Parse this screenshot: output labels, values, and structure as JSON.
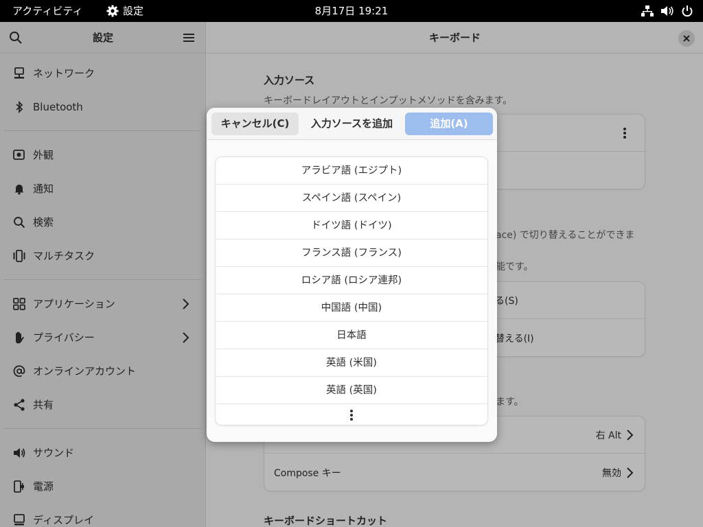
{
  "topbar": {
    "activities": "アクティビティ",
    "app_name": "設定",
    "clock": "8月17日 19:21",
    "tray_icons": [
      "network-icon",
      "volume-icon",
      "power-icon"
    ]
  },
  "sidebar": {
    "title": "設定",
    "groups": [
      [
        {
          "label": "ネットワーク",
          "icon": "network-icon"
        },
        {
          "label": "Bluetooth",
          "icon": "bluetooth-icon"
        }
      ],
      [
        {
          "label": "外観",
          "icon": "appearance-icon"
        },
        {
          "label": "通知",
          "icon": "bell-icon"
        },
        {
          "label": "検索",
          "icon": "search-icon"
        },
        {
          "label": "マルチタスク",
          "icon": "multitask-icon"
        }
      ],
      [
        {
          "label": "アプリケーション",
          "icon": "apps-icon",
          "chevron": true
        },
        {
          "label": "プライバシー",
          "icon": "hand-icon",
          "chevron": true
        },
        {
          "label": "オンラインアカウント",
          "icon": "at-icon"
        },
        {
          "label": "共有",
          "icon": "share-icon"
        }
      ],
      [
        {
          "label": "サウンド",
          "icon": "sound-icon"
        },
        {
          "label": "電源",
          "icon": "power-plug-icon"
        },
        {
          "label": "ディスプレイ",
          "icon": "display-icon"
        }
      ]
    ]
  },
  "main": {
    "title": "キーボード",
    "input_sources_heading": "入力ソース",
    "input_sources_desc": "キーボードレイアウトとインプットメソッドを含みます。",
    "switch_desc_partial": "ace) で切り替えることができま",
    "switch_desc_partial2": "能です。",
    "switch_row1_partial": "る(S)",
    "switch_row2_partial": "替える(I)",
    "special_desc_partial": "ます。",
    "alt_key_value": "右 Alt",
    "compose_label": "Compose キー",
    "compose_value": "無効",
    "shortcuts_heading": "キーボードショートカット"
  },
  "dialog": {
    "cancel_label": "キャンセル(C)",
    "title": "入力ソースを追加",
    "add_label": "追加(A)",
    "languages": [
      "アラビア語 (エジプト)",
      "スペイン語 (スペイン)",
      "ドイツ語 (ドイツ)",
      "フランス語 (フランス)",
      "ロシア語 (ロシア連邦)",
      "中国語 (中国)",
      "日本語",
      "英語 (米国)",
      "英語 (英国)"
    ]
  }
}
